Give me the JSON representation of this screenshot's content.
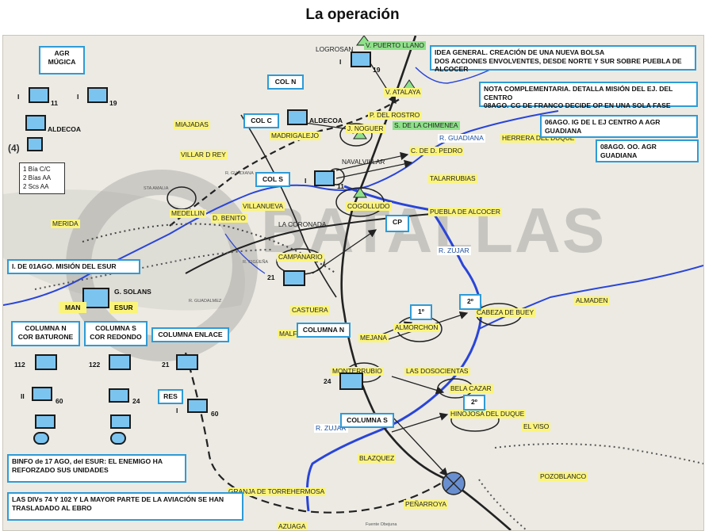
{
  "title": "La operación",
  "watermark": "BATALLAS",
  "colors": {
    "accent_box_border": "#2e9bd6",
    "unit_fill": "#7cc4f0",
    "road": "#222222",
    "river": "#2a45d8",
    "highlight_yellow": "#fbf47a",
    "highlight_green": "#8fe08a"
  },
  "boxes": {
    "agr_mugica": "AGR\nMÚGICA",
    "col_n": "COL N",
    "col_c": "COL C",
    "col_s": "COL S",
    "cp": "CP",
    "idea": "IDEA GENERAL. CREACIÓN DE UNA NUEVA BOLSA\nDOS ACCIONES ENVOLVENTES, DESDE NORTE Y SUR SOBRE PUEBLA DE ALCOCER",
    "nota": "NOTA COMPLEMENTARIA. DETALLA MISIÓN DEL EJ. DEL CENTRO\n08AGO. CG DE FRANCO DECIDE OP EN UNA SOLA FASE",
    "ago06": "06AGO. IG DE L EJ CENTRO A AGR GUADIANA",
    "ago08": "08AGO. OO. AGR GUADIANA",
    "mision": "I. DE 01AGO. MISIÓN DEL ESUR",
    "columna_n_bat": "COLUMNA N\nCOR BATURONE",
    "columna_s_red": "COLUMNA S\nCOR REDONDO",
    "columna_enlace": "COLUMNA ENLACE",
    "columna_n": "COLUMNA N",
    "columna_s": "COLUMNA S",
    "first": "1º",
    "second_a": "2º",
    "second_b": "2º",
    "binfo": "BINFO de 17 AGO, del ESUR: EL ENEMIGO HA REFORZADO SUS UNIDADES",
    "divs": "LAS DIVs 74 Y 102   Y LA MAYOR PARTE DE LA AVIACIÓN SE HAN TRASLADADO AL EBRO",
    "res": "RES"
  },
  "legend": {
    "line1": "1 Bía C/C",
    "line2": "2 Bías AA",
    "line3": "2 Scs AA"
  },
  "units": {
    "i_left": "I",
    "n11_left": "11",
    "i_mid": "I",
    "n19_left": "19",
    "aldecoa_top": "ALDECOA",
    "four": "(4)",
    "aldecoa_colc": "ALDECOA",
    "i_top": "I",
    "n19_top": "19",
    "i_cols": "I",
    "n11_cols": "11",
    "n21_camp": "21",
    "g_solans": "G. SOLANS",
    "man": "MAN",
    "esur": "ESUR",
    "n112": "112",
    "n122": "122",
    "n21": "21",
    "ii": "II",
    "n60": "60",
    "n24": "24",
    "i_res": "I",
    "n60_res": "60",
    "n24_mont": "24"
  },
  "places": {
    "logrosan": "LOGROSAN",
    "v_puerto_llano": "V. PUERTO LLANO",
    "v_atalaya": "V. ATALAYA",
    "p_del_rostro": "P. DEL ROSTRO",
    "j_noguer": "J. NOGUER",
    "s_chimenea": "S. DE LA CHIMENEA",
    "r_guadiana": "R. GUADIANA",
    "herrera": "HERRERA DEL DUQUE",
    "c_de_d_pedro": "C. DE D. PEDRO",
    "miajadas": "MIAJADAS",
    "madrigalejo": "MADRIGALEJO",
    "villar_d_rey": "VILLAR D REY",
    "navalvillar": "NAVALVILLAR",
    "talarrubias": "TALARRUBIAS",
    "cogolludo": "COGOLLUDO",
    "puebla": "PUEBLA DE ALCOCER",
    "villanueva": "VILLANUEVA",
    "d_benito": "D. BENITO",
    "medellin": "MEDELLIN",
    "merida": "MERIDA",
    "la_coronada": "LA CORONADA",
    "campanario": "CAMPANARIO",
    "r_zujar": "R. ZUJAR",
    "almaden": "ALMADEN",
    "castuera": "CASTUERA",
    "almorchon": "ALMORCHON",
    "cabeza_buey": "CABEZA DE BUEY",
    "mejana": "MEJANA",
    "malf": "MALF",
    "monterrubio": "MONTERRUBIO",
    "las_dosocientas": "LAS DOSOCIENTAS",
    "bela_cazar": "BELA CAZAR",
    "hinojosa": "HINOJOSA DEL DUQUE",
    "el_viso": "EL VISO",
    "r_zujar_s": "R. ZUJAR",
    "blazquez": "BLAZQUEZ",
    "pozoblanco": "POZOBLANCO",
    "granja": "GRANJA DE TORREHERMOSA",
    "penarroya": "PEÑARROYA",
    "azuaga": "AZUAGA",
    "sta_amalia": "STA AMALIA",
    "r_cigueña": "R. CIGÜEÑA",
    "guadalmez": "R. GUADALMEZ",
    "r_guadiana_w": "R. GUADIANA",
    "fuente_obejuna": "Fuente Obejuna"
  }
}
